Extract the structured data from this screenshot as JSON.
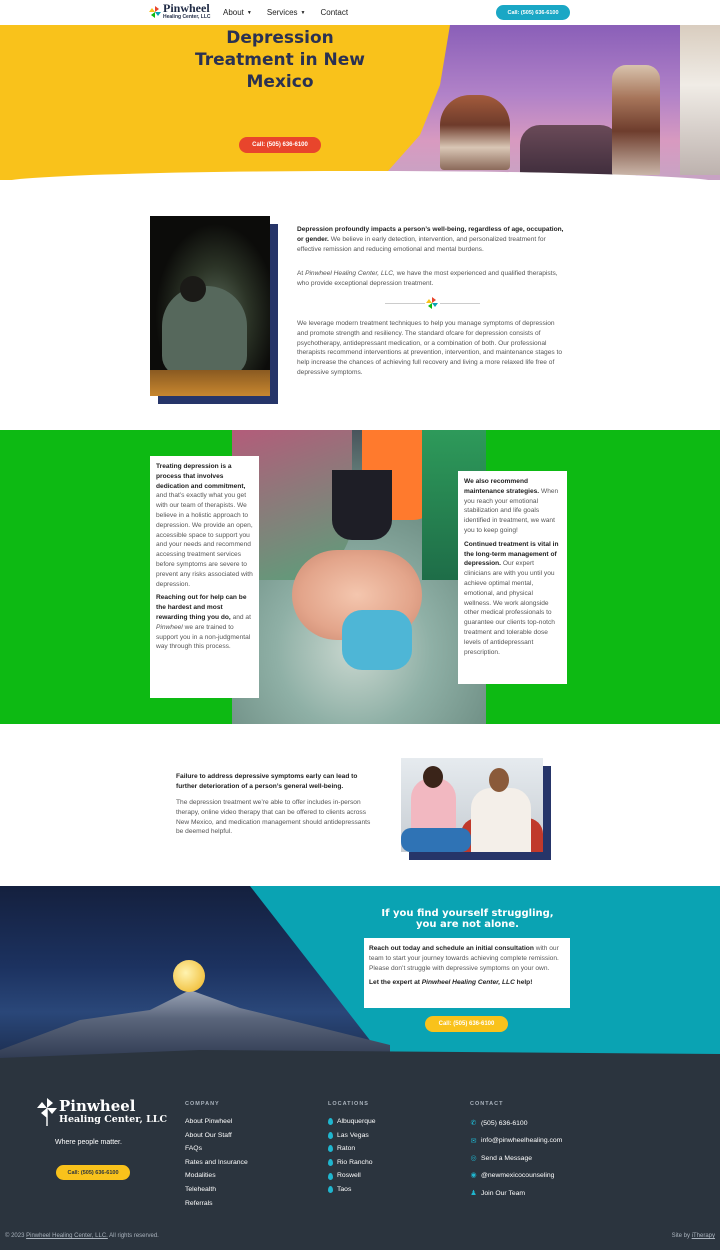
{
  "header": {
    "logo_title": "Pinwheel",
    "logo_subtitle": "Healing Center, LLC",
    "nav": [
      {
        "label": "About",
        "has_dropdown": true
      },
      {
        "label": "Services",
        "has_dropdown": true
      },
      {
        "label": "Contact",
        "has_dropdown": false
      }
    ],
    "call_button": "Call: (505) 636-6100"
  },
  "hero": {
    "title": "Depression Treatment in New Mexico",
    "call_button": "Call: (505) 636-6100"
  },
  "intro": {
    "p1_bold": "Depression profoundly impacts a person’s well-being, regardless of age, occupation, or gender.",
    "p1_rest": " We believe in early detection, intervention, and personalized treatment for effective remission and reducing emotional and mental burdens.",
    "p2_pre": "At ",
    "p2_italic": "Pinwheel Healing Center, LLC,",
    "p2_rest": " we have the most experienced and qualified therapists, who provide exceptional depression treatment.",
    "p3": "We leverage modern treatment techniques to help you manage symptoms of depression and promote strength and resiliency. The standard ofcare for depression consists of psychotherapy, antidepressant medication, or a combination of both. Our professional therapists recommend interventions at prevention, intervention, and maintenance stages to help increase the chances of achieving full recovery and living a more relaxed life free of depressive symptoms."
  },
  "green_section": {
    "left_p1_bold": "Treating depression is a process that involves dedication and commitment,",
    "left_p1_rest": " and that’s exactly what you get with our team of therapists. We believe in a holistic approach to depression. We provide an open, accessible space to support you and your needs and recommend accessing treatment services before symptoms are severe to prevent any risks associated with depression.",
    "left_p2_bold": "Reaching out for help can be the hardest and most rewarding thing you do,",
    "left_p2_pre": " and at ",
    "left_p2_italic": "Pinwheel",
    "left_p2_rest": " we are trained to support you in a non-judgmental way through this process.",
    "right_p1_bold": "We also recommend maintenance strategies.",
    "right_p1_rest": " When you reach your emotional stabilization and life goals identified in treatment, we want you to keep going!",
    "right_p2_bold": "Continued treatment is vital in the long-term management of depression.",
    "right_p2_rest": " Our expert clinicians are with you until you achieve optimal mental, emotional, and physical wellness. We work alongside other medical professionals to guarantee our clients top-notch treatment and tolerable dose levels of antidepressant prescription."
  },
  "failure": {
    "bold": "Failure to address depressive symptoms early can lead to further deterioration of a person’s general well-being.",
    "text": "The depression treatment we’re able to offer includes in-person therapy, online video therapy that can be offered to clients across New Mexico, and medication management should antidepressants be deemed helpful."
  },
  "struggling": {
    "title": "If you find yourself struggling, you are not alone.",
    "p1_bold": "Reach out today and schedule an initial consultation",
    "p1_rest": " with our team to start your journey towards achieving complete remission. Please don’t struggle with depressive symptoms on your own.",
    "p2_pre": "Let the expert at ",
    "p2_italic": "Pinwheel Healing Center, LLC",
    "p2_post": " help!",
    "call_button": "Call: (505) 636-6100"
  },
  "footer": {
    "logo_title": "Pinwheel",
    "logo_subtitle": "Healing Center, LLC",
    "tagline": "Where people matter.",
    "call_button": "Call: (505) 636-6100",
    "company_heading": "COMPANY",
    "company_links": [
      "About Pinwheel",
      "About Our Staff",
      "FAQs",
      "Rates and Insurance",
      "Modalities",
      "Telehealth",
      "Referrals"
    ],
    "locations_heading": "LOCATIONS",
    "locations": [
      "Albuquerque",
      "Las Vegas",
      "Raton",
      "Rio Rancho",
      "Roswell",
      "Taos"
    ],
    "contact_heading": "CONTACT",
    "contact": [
      {
        "icon": "phone-icon",
        "label": "(505) 636-6100"
      },
      {
        "icon": "email-icon",
        "label": "info@pinwheelhealing.com"
      },
      {
        "icon": "message-icon",
        "label": "Send a Message"
      },
      {
        "icon": "instagram-icon",
        "label": "@newmexicocounseling"
      },
      {
        "icon": "team-icon",
        "label": "Join Our Team"
      }
    ],
    "copyright_pre": "© 2023 ",
    "copyright_link": "Pinwheel Healing Center, LLC.",
    "copyright_post": " All rights reserved.",
    "siteby_pre": "Site by ",
    "siteby_link": "iTherapy"
  },
  "colors": {
    "yellow": "#f9c21b",
    "navy": "#2a3152",
    "green": "#0dba13",
    "teal": "#0aa3b3",
    "red_button": "#e8452c",
    "footer_bg": "#2b343e"
  }
}
